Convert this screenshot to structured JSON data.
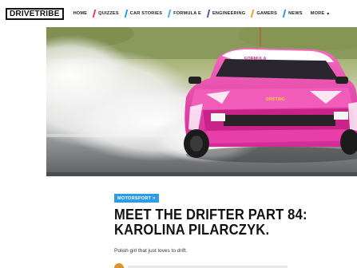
{
  "nav": {
    "logo": "DRIVETRIBE",
    "items": [
      {
        "label": "HOME",
        "accent": ""
      },
      {
        "label": "QUIZZES",
        "accent": "#e63a7a"
      },
      {
        "label": "CAR STORIES",
        "accent": "#2e9be6"
      },
      {
        "label": "FORMULA E",
        "accent": "#46b7e8"
      },
      {
        "label": "ENGINEERING",
        "accent": "#6f42c1"
      },
      {
        "label": "GAMERS",
        "accent": "#f0a12b"
      },
      {
        "label": "NEWS",
        "accent": "#2e9be6"
      },
      {
        "label": "MORE",
        "accent": ""
      }
    ]
  },
  "hero": {
    "car_color": "#e83ea8",
    "windshield_text": "FORMULA",
    "hood_text": "DRIFTING"
  },
  "article": {
    "category": "MOTORSPORT >",
    "category_color": "#2e9be6",
    "title_line1": "MEET THE DRIFTER PART 84:",
    "title_line2": "KAROLINA PILARCZYK.",
    "subtitle": "Polish girl that just loves to drift."
  }
}
